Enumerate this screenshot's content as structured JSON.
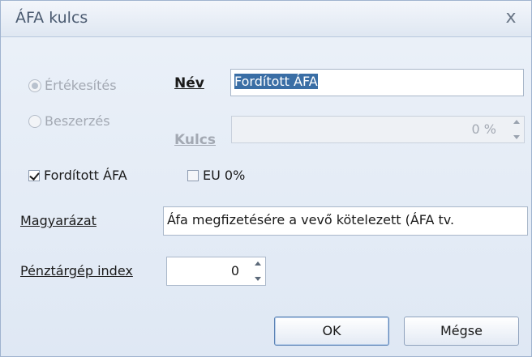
{
  "dialog": {
    "title": "ÁFA kulcs",
    "close_glyph": "x"
  },
  "radios": [
    {
      "label": "Értékesítés",
      "checked": true,
      "enabled": false
    },
    {
      "label": "Beszerzés",
      "checked": false,
      "enabled": false
    }
  ],
  "name_field": {
    "label": "Név",
    "value": "Fordított ÁFA"
  },
  "rate_field": {
    "label": "Kulcs",
    "value": "0 %",
    "enabled": false
  },
  "checkboxes": [
    {
      "label": "Fordított ÁFA",
      "checked": true
    },
    {
      "label": "EU 0%",
      "checked": false
    }
  ],
  "explanation_field": {
    "label": "Magyarázat",
    "value": "Áfa megfizetésére a vevő kötelezett (ÁFA tv."
  },
  "register_index": {
    "label": "Pénztárgép index",
    "value": "0"
  },
  "buttons": {
    "ok": "OK",
    "cancel": "Mégse"
  },
  "icons": {
    "close": "close-icon",
    "spinner": "spinner-arrows-icon"
  }
}
